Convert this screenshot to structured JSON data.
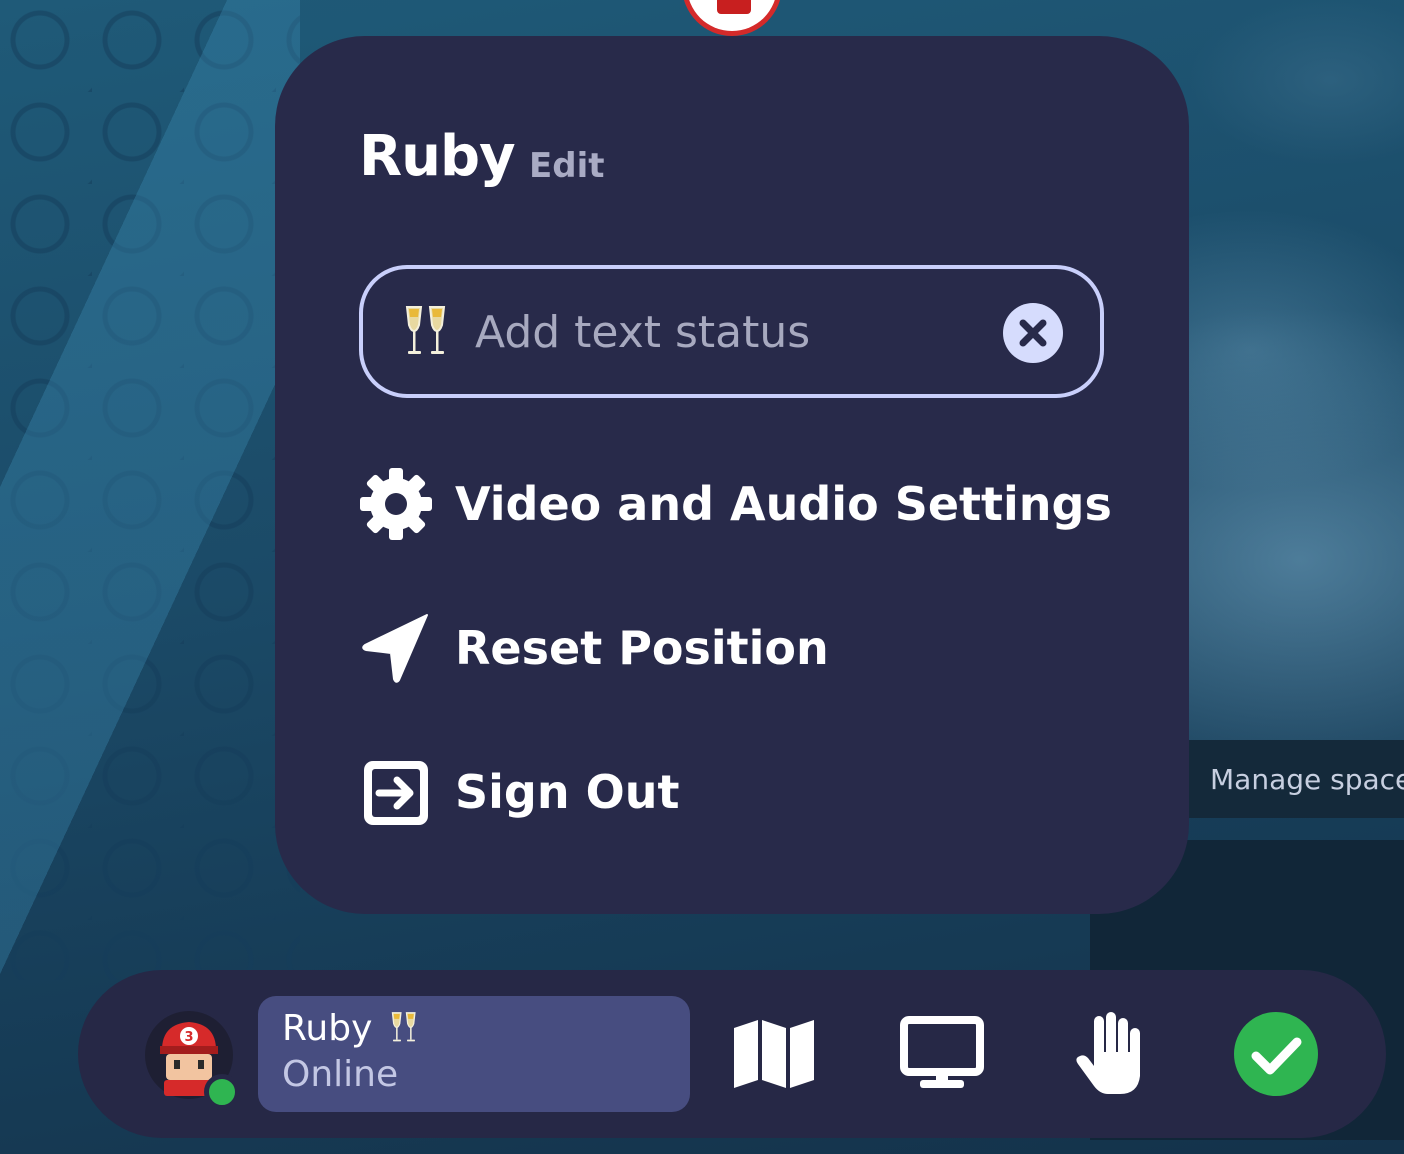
{
  "background": {
    "manage_space_label": "Manage space"
  },
  "profile_menu": {
    "name": "Ruby",
    "edit_label": "Edit",
    "status_input": {
      "emoji_icon": "champagne-glasses-icon",
      "placeholder": "Add text status",
      "value": ""
    },
    "items": [
      {
        "label": "Video and Audio Settings",
        "icon": "gear-icon"
      },
      {
        "label": "Reset Position",
        "icon": "location-arrow-icon"
      },
      {
        "label": "Sign Out",
        "icon": "sign-out-icon"
      }
    ]
  },
  "bottom_bar": {
    "user": {
      "name": "Ruby",
      "emoji_icon": "champagne-glasses-icon",
      "status": "Online",
      "presence_color": "#2fb551"
    },
    "buttons": [
      {
        "icon": "map-icon"
      },
      {
        "icon": "screen-share-icon"
      },
      {
        "icon": "raise-hand-icon"
      },
      {
        "icon": "ready-check-icon",
        "color": "#2fb551"
      }
    ]
  },
  "colors": {
    "panel": "#282a4a",
    "bar": "#262846",
    "user_card": "#474d80",
    "input_border": "#c9cffb",
    "accent_green": "#2fb551"
  }
}
